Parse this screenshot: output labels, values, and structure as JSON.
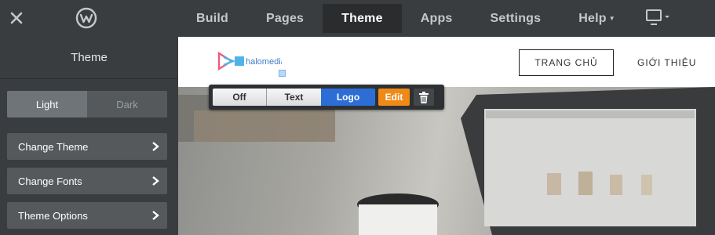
{
  "topbar": {
    "nav": [
      {
        "label": "Build",
        "active": false
      },
      {
        "label": "Pages",
        "active": false
      },
      {
        "label": "Theme",
        "active": true
      },
      {
        "label": "Apps",
        "active": false
      },
      {
        "label": "Settings",
        "active": false
      },
      {
        "label": "Help",
        "active": false,
        "has_dropdown": true
      }
    ]
  },
  "sidebar": {
    "title": "Theme",
    "mode": {
      "options": [
        "Light",
        "Dark"
      ],
      "selected": "Light"
    },
    "items": [
      {
        "label": "Change Theme"
      },
      {
        "label": "Change Fonts"
      },
      {
        "label": "Theme Options"
      }
    ]
  },
  "preview": {
    "logo_text": "halomedia",
    "nav": [
      {
        "label": "TRANG CHỦ",
        "active": true
      },
      {
        "label": "GIỚI THIỆU",
        "active": false
      }
    ]
  },
  "logo_toolbar": {
    "off_label": "Off",
    "text_label": "Text",
    "logo_label": "Logo",
    "edit_label": "Edit",
    "selected": "Logo"
  },
  "colors": {
    "accent_blue": "#2d6ed6",
    "edit_orange": "#ef8a17",
    "chrome_dark": "#3a3d40"
  }
}
